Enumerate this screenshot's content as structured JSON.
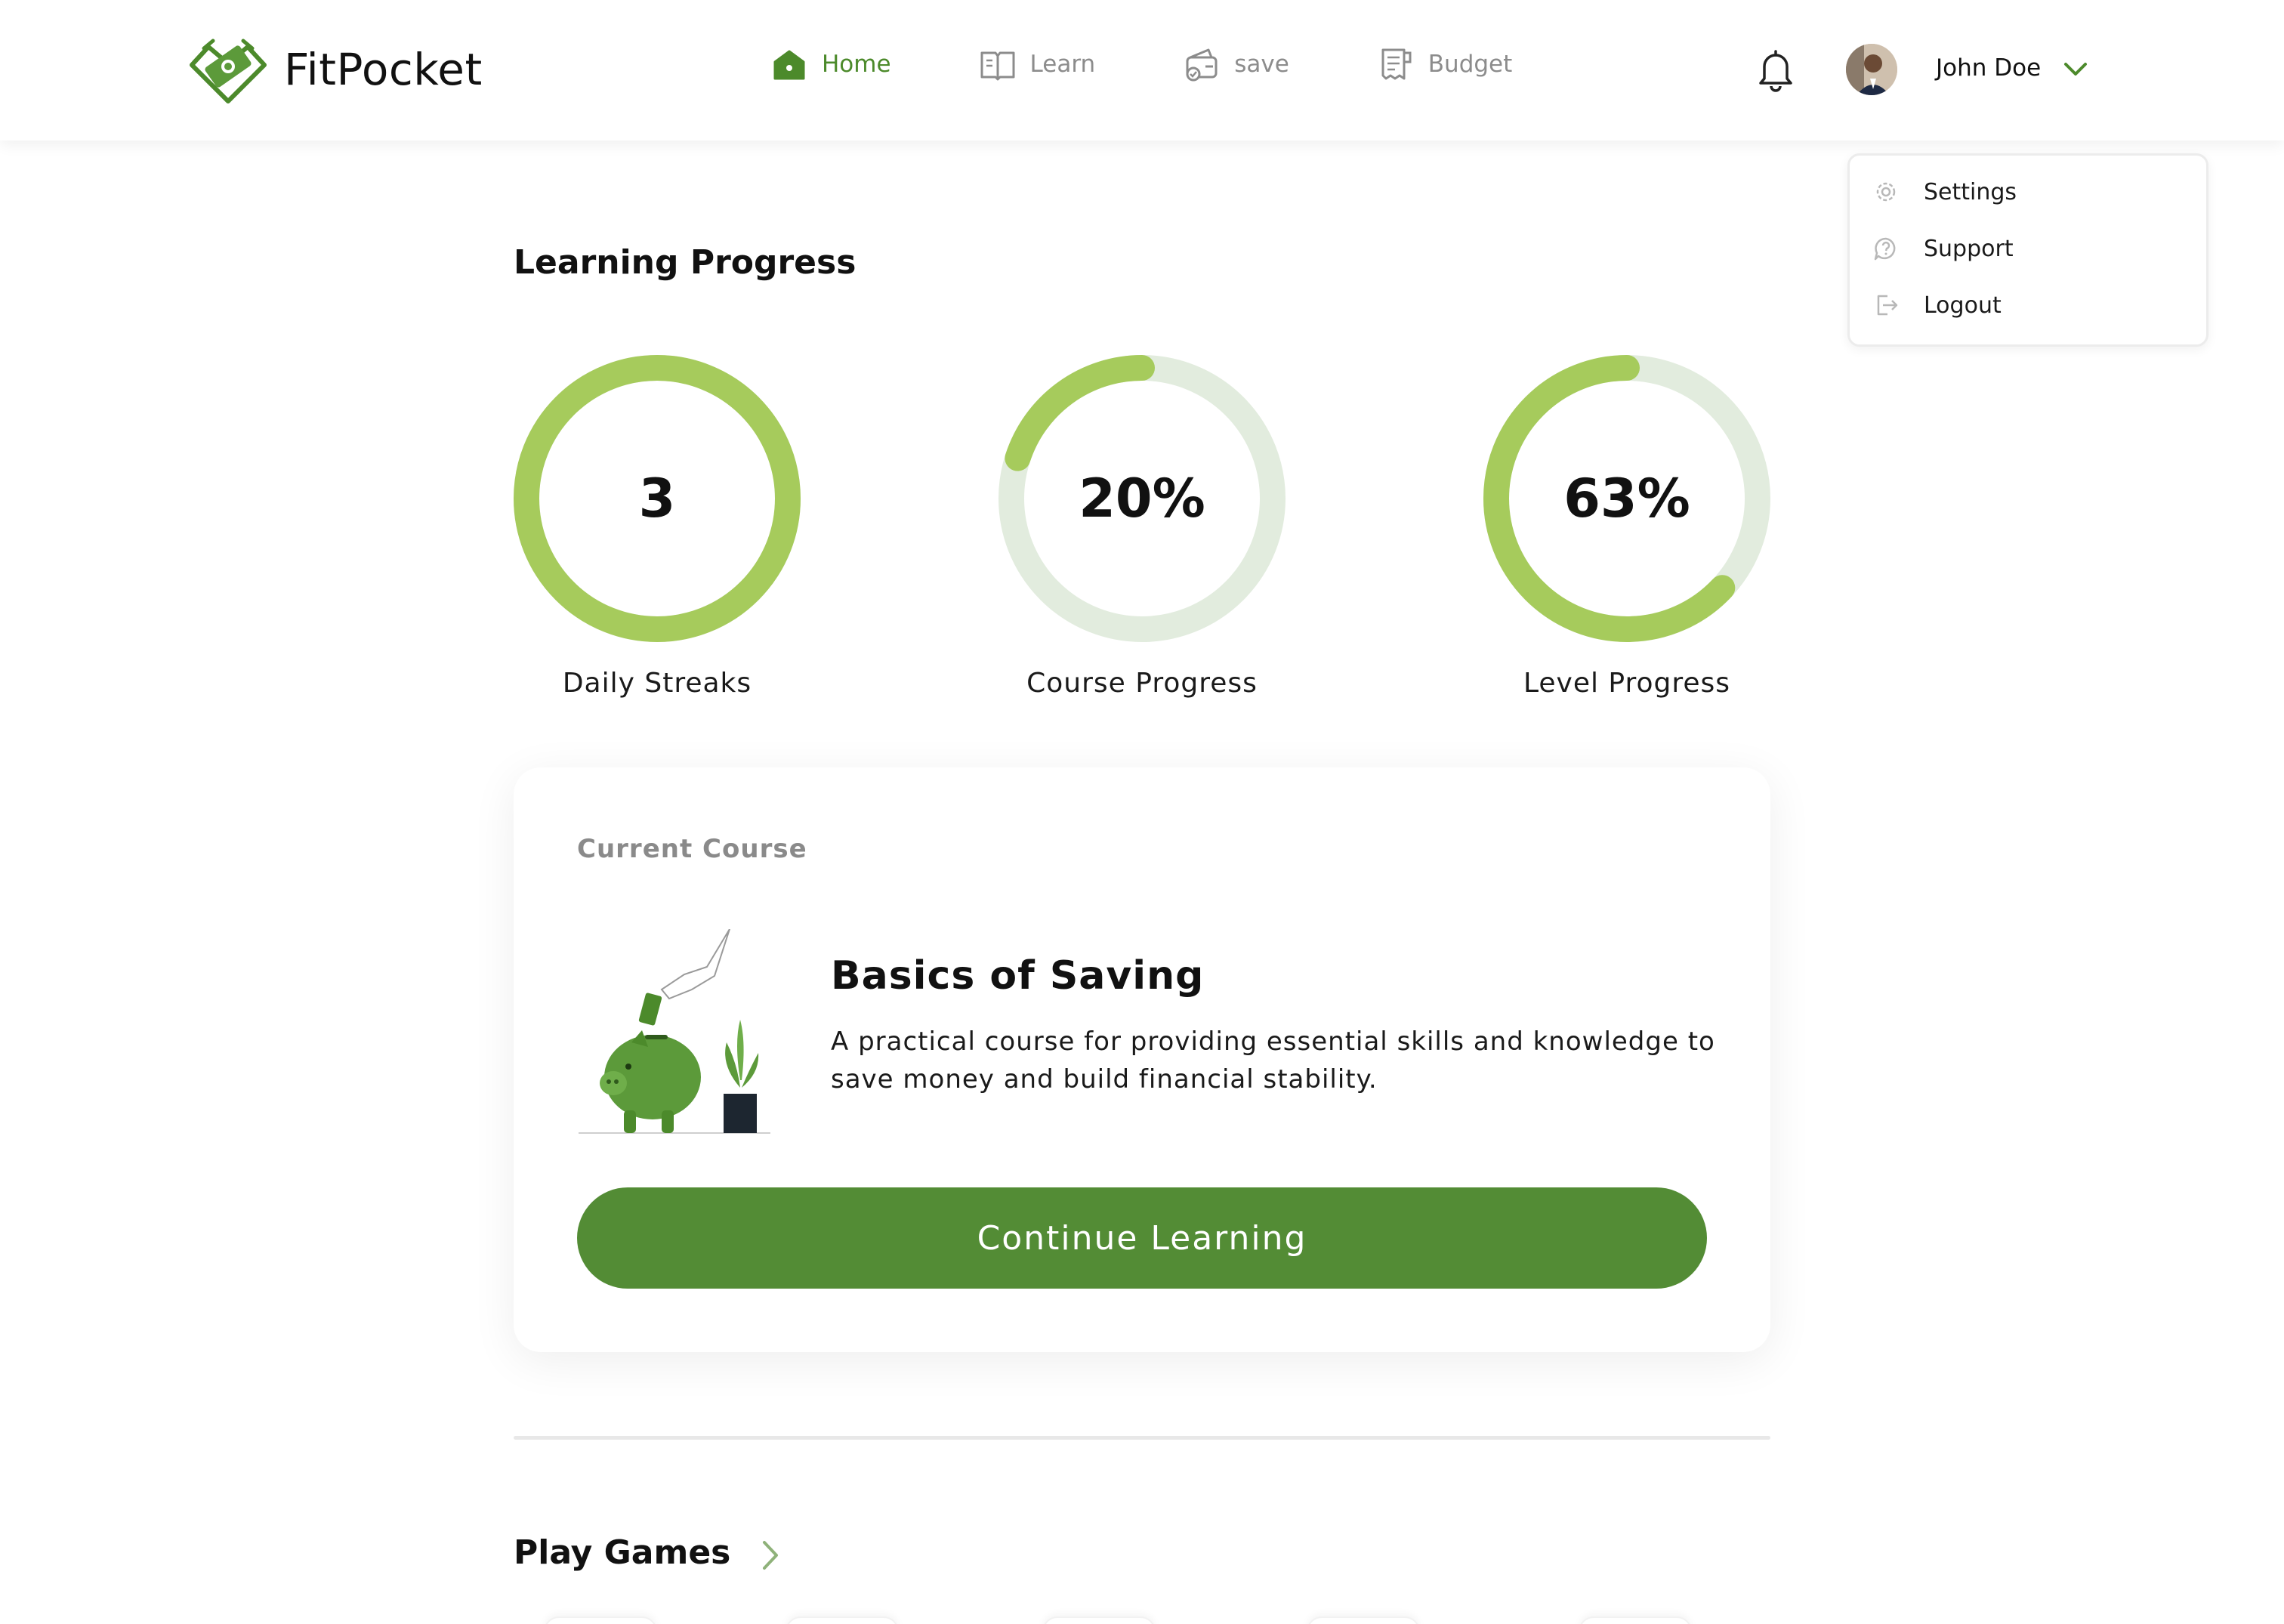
{
  "app": {
    "name": "FitPocket",
    "accent": "#4c8a2b",
    "button_color": "#538c35",
    "ring_color": "#a6cb5c",
    "ring_track": "#e2ecde"
  },
  "nav": {
    "items": [
      {
        "label": "Home",
        "icon": "home-icon",
        "active": true
      },
      {
        "label": "Learn",
        "icon": "book-icon",
        "active": false
      },
      {
        "label": "save",
        "icon": "wallet-icon",
        "active": false
      },
      {
        "label": "Budget",
        "icon": "receipt-icon",
        "active": false
      }
    ]
  },
  "user": {
    "name": "John Doe",
    "avatar_icon": "user-avatar"
  },
  "dropdown": {
    "items": [
      {
        "label": "Settings",
        "icon": "gear-icon"
      },
      {
        "label": "Support",
        "icon": "help-icon"
      },
      {
        "label": "Logout",
        "icon": "logout-icon"
      }
    ]
  },
  "learning_progress": {
    "title": "Learning Progress",
    "rings": [
      {
        "value_text": "3",
        "label": "Daily Streaks",
        "fraction": 1.0
      },
      {
        "value_text": "20%",
        "label": "Course Progress",
        "fraction": 0.2
      },
      {
        "value_text": "63%",
        "label": "Level Progress",
        "fraction": 0.63
      }
    ]
  },
  "current_course": {
    "heading": "Current Course",
    "title": "Basics of Saving",
    "description": "A practical course for providing essential skills and knowledge to save money and build financial stability.",
    "cta_label": "Continue Learning"
  },
  "games": {
    "title": "Play Games"
  }
}
